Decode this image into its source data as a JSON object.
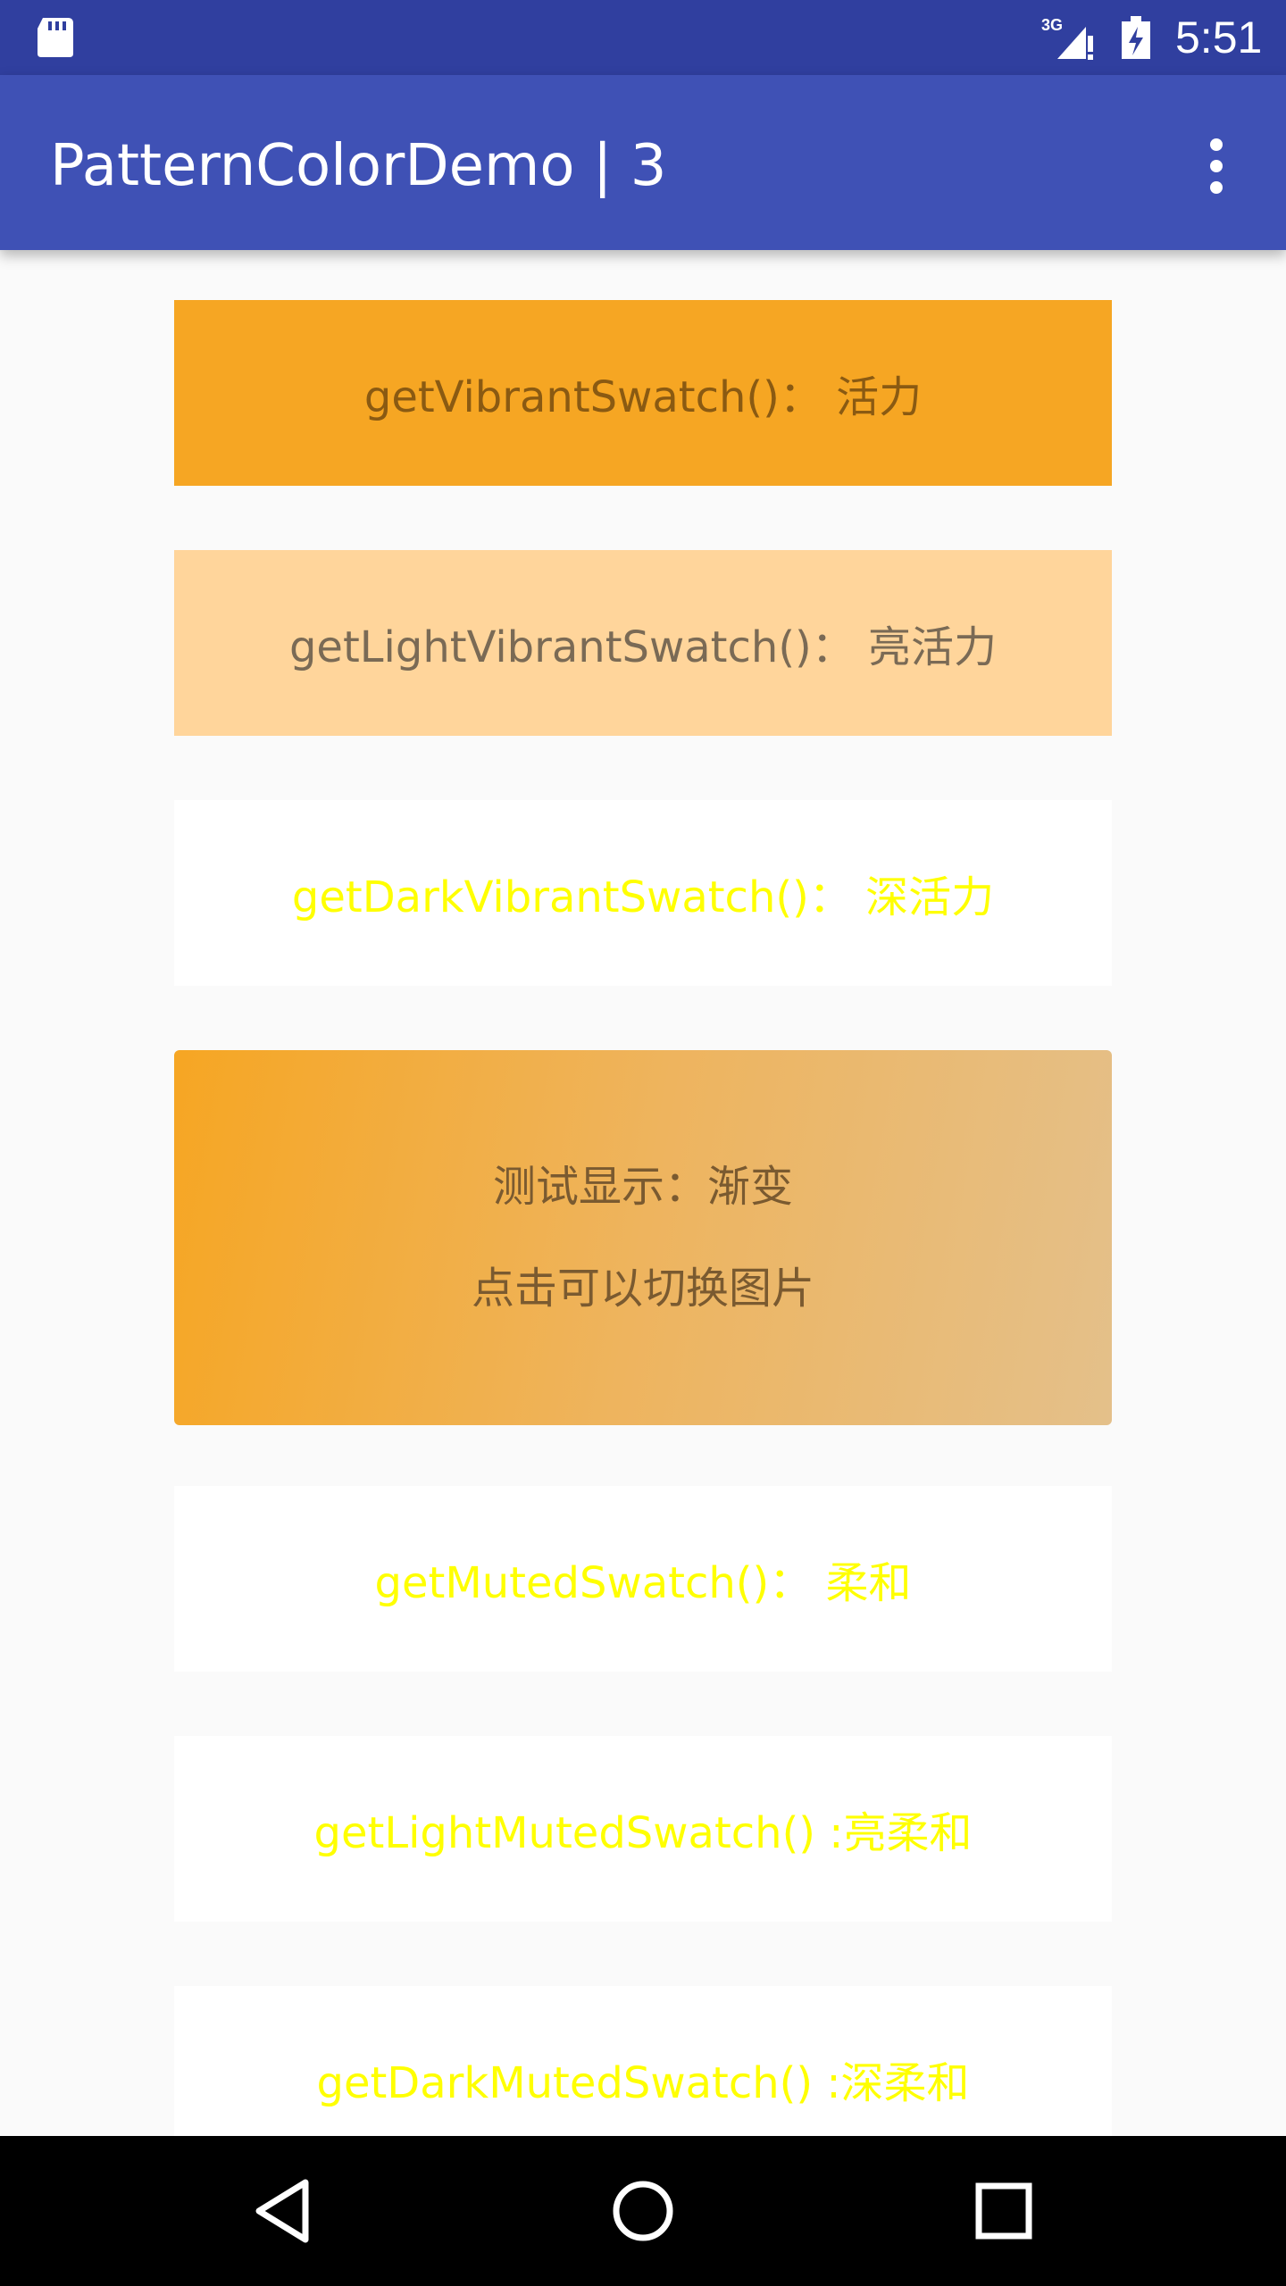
{
  "status_bar": {
    "time": "5:51",
    "network": "3G",
    "icons": [
      "sd-card-icon",
      "signal-3g-icon",
      "battery-charging-icon"
    ]
  },
  "app_bar": {
    "title": "PatternColorDemo | 3",
    "overflow_icon": "more-vert-icon"
  },
  "cards": [
    {
      "label": "getVibrantSwatch()： 活力"
    },
    {
      "label": "getLightVibrantSwatch()： 亮活力"
    },
    {
      "label": "getDarkVibrantSwatch()： 深活力"
    },
    {
      "line1": "测试显示：渐变",
      "line2": "点击可以切换图片"
    },
    {
      "label": "getMutedSwatch()： 柔和"
    },
    {
      "label": "getLightMutedSwatch() :亮柔和"
    },
    {
      "label": "getDarkMutedSwatch() :深柔和"
    }
  ],
  "colors": {
    "status_bar": "#303f9f",
    "app_bar": "#3f51b5",
    "vibrant": "#f6a623",
    "light_vibrant": "#ffd59b",
    "swatch_text_yellow": "#ffff00",
    "background": "#fafafa"
  },
  "nav_bar": {
    "icons": [
      "back-icon",
      "home-icon",
      "recents-icon"
    ]
  }
}
